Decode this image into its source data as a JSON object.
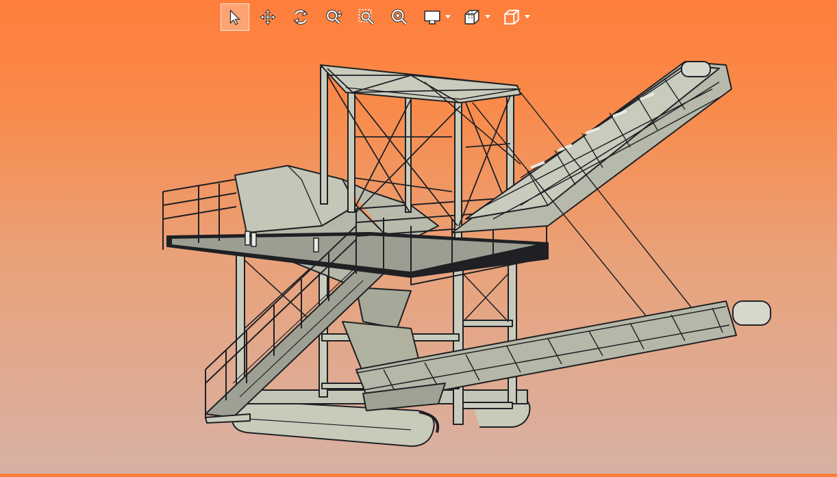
{
  "toolbar": {
    "buttons": [
      {
        "id": "select",
        "icon": "pointer-icon",
        "active": true
      },
      {
        "id": "pan",
        "icon": "pan-icon"
      },
      {
        "id": "rotate",
        "icon": "rotate-icon"
      },
      {
        "id": "zoom",
        "icon": "zoom-updown-icon"
      },
      {
        "id": "zoom-window",
        "icon": "zoom-window-icon"
      },
      {
        "id": "zoom-fit",
        "icon": "zoom-fit-icon"
      },
      {
        "id": "display",
        "icon": "monitor-icon",
        "dropdown": true
      },
      {
        "id": "section",
        "icon": "section-box-icon",
        "dropdown": true
      },
      {
        "id": "view-cube",
        "icon": "view-cube-icon",
        "dropdown": true
      }
    ]
  },
  "model": {
    "name": "",
    "colors": {
      "steel": "#c9cbbd",
      "edge": "#1e2024",
      "shadow": "#8d8f84",
      "roller": "#e8e8e2"
    }
  }
}
